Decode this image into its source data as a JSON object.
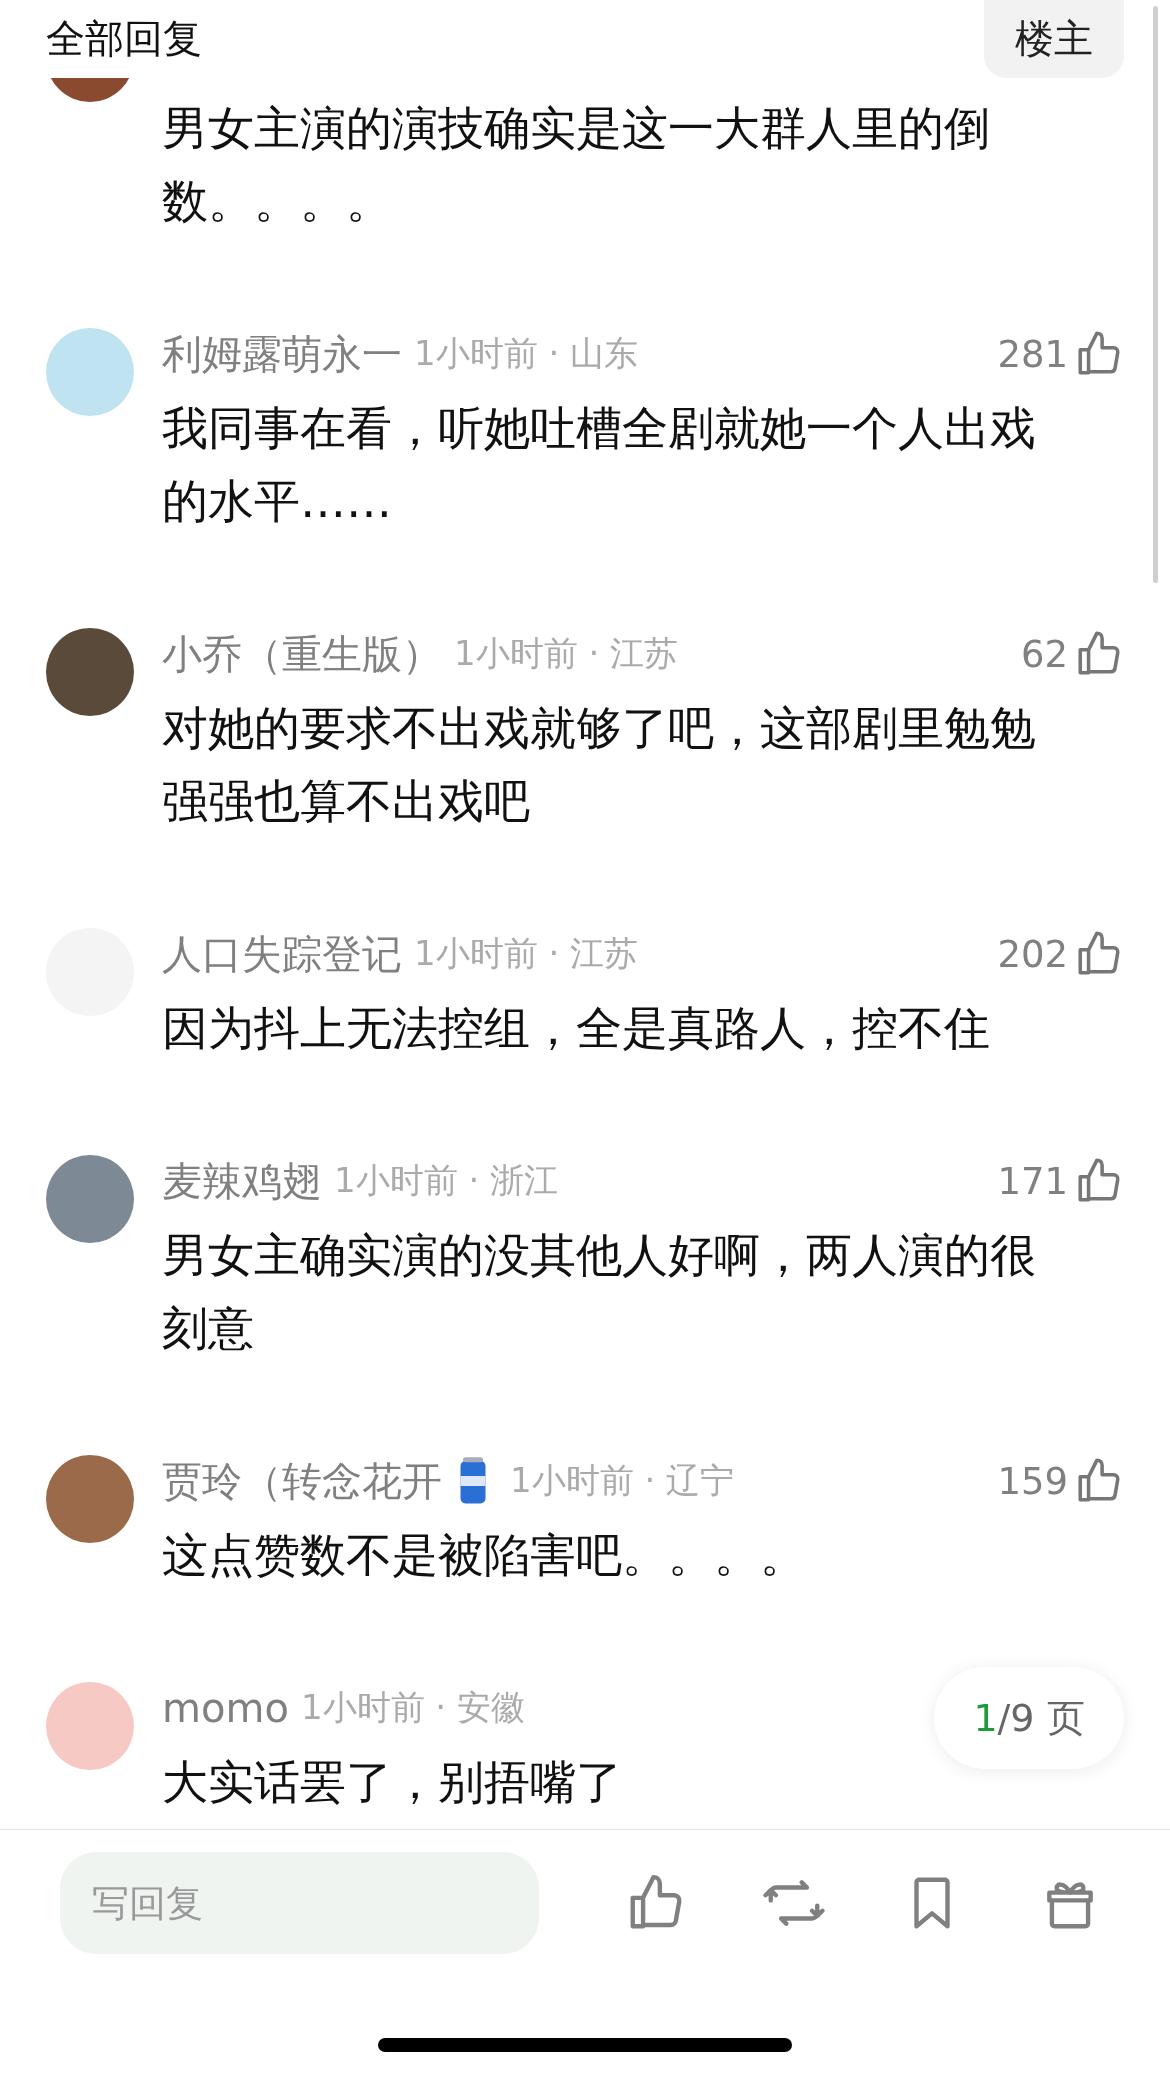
{
  "header": {
    "title": "全部回复",
    "owner_filter": "楼主"
  },
  "comments": [
    {
      "kind": "cut",
      "body": "男女主演的演技确实是这一大群人里的倒数。。。。"
    },
    {
      "kind": "full",
      "name": "利姆露萌永一",
      "meta": "1小时前 · 山东",
      "likes": "281",
      "body": "我同事在看，听她吐槽全剧就她一个人出戏的水平……"
    },
    {
      "kind": "full",
      "name": "小乔（重生版）",
      "meta": "1小时前 · 江苏",
      "likes": "62",
      "body": "对她的要求不出戏就够了吧，这部剧里勉勉强强也算不出戏吧"
    },
    {
      "kind": "full",
      "name": "人口失踪登记",
      "meta": "1小时前 · 江苏",
      "likes": "202",
      "body": "因为抖上无法控组，全是真路人，控不住"
    },
    {
      "kind": "full",
      "name": "麦辣鸡翅",
      "meta": "1小时前 · 浙江",
      "likes": "171",
      "body": "男女主确实演的没其他人好啊，两人演的很刻意"
    },
    {
      "kind": "full",
      "name": "贾玲（转念花开",
      "badge_icon": true,
      "meta": "1小时前 · 辽宁",
      "likes": "159",
      "body": "这点赞数不是被陷害吧。。。。"
    },
    {
      "kind": "full",
      "name": "momo",
      "meta": "1小时前 · 安徽",
      "body": "大实话罢了，别捂嘴了"
    }
  ],
  "pager": {
    "current": "1",
    "rest": "/9 页"
  },
  "reply": {
    "placeholder": "写回复"
  }
}
